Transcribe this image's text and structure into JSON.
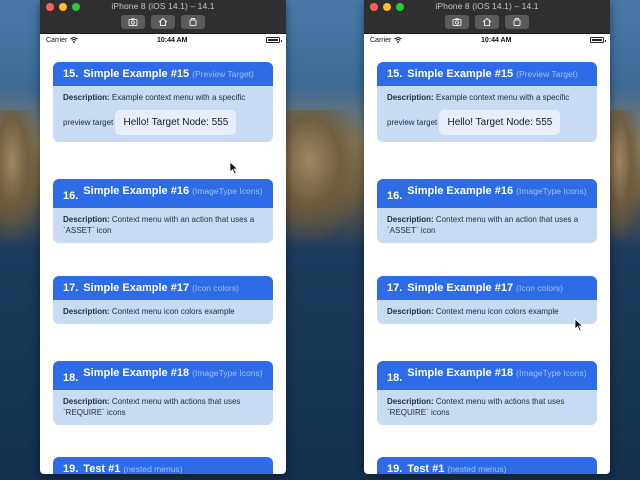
{
  "window": {
    "title": "iPhone 8 (iOS 14.1) – 14.1",
    "toolbar": [
      "screenshot-icon",
      "home-icon",
      "rotate-icon"
    ]
  },
  "status_bar": {
    "carrier": "Carrier",
    "time": "10:44 AM"
  },
  "cards": [
    {
      "num": "15.",
      "title": "Simple Example #15",
      "subtitle": "(Preview Target)",
      "desc_label": "Description:",
      "desc": "Example context menu with a specific preview target",
      "extra": "Hello! Target Node: 555"
    },
    {
      "num": "16.",
      "title": "Simple Example #16",
      "subtitle": "(ImageType Icons)",
      "desc_label": "Description:",
      "desc": "Context menu with an action that uses a `ASSET` icon"
    },
    {
      "num": "17.",
      "title": "Simple Example #17",
      "subtitle": "(Icon colors)",
      "desc_label": "Description:",
      "desc": "Context menu icon colors example"
    },
    {
      "num": "18.",
      "title": "Simple Example #18",
      "subtitle": "(ImageType Icons)",
      "desc_label": "Description:",
      "desc": "Context menu with actions that uses `REQUIRE` icons"
    },
    {
      "num": "19.",
      "title": "Test #1",
      "subtitle": "(nested menus)"
    }
  ],
  "colors": {
    "card_header": "#2e6be6",
    "card_body": "#c9dbf2",
    "subtitle": "#9fc0ff"
  }
}
